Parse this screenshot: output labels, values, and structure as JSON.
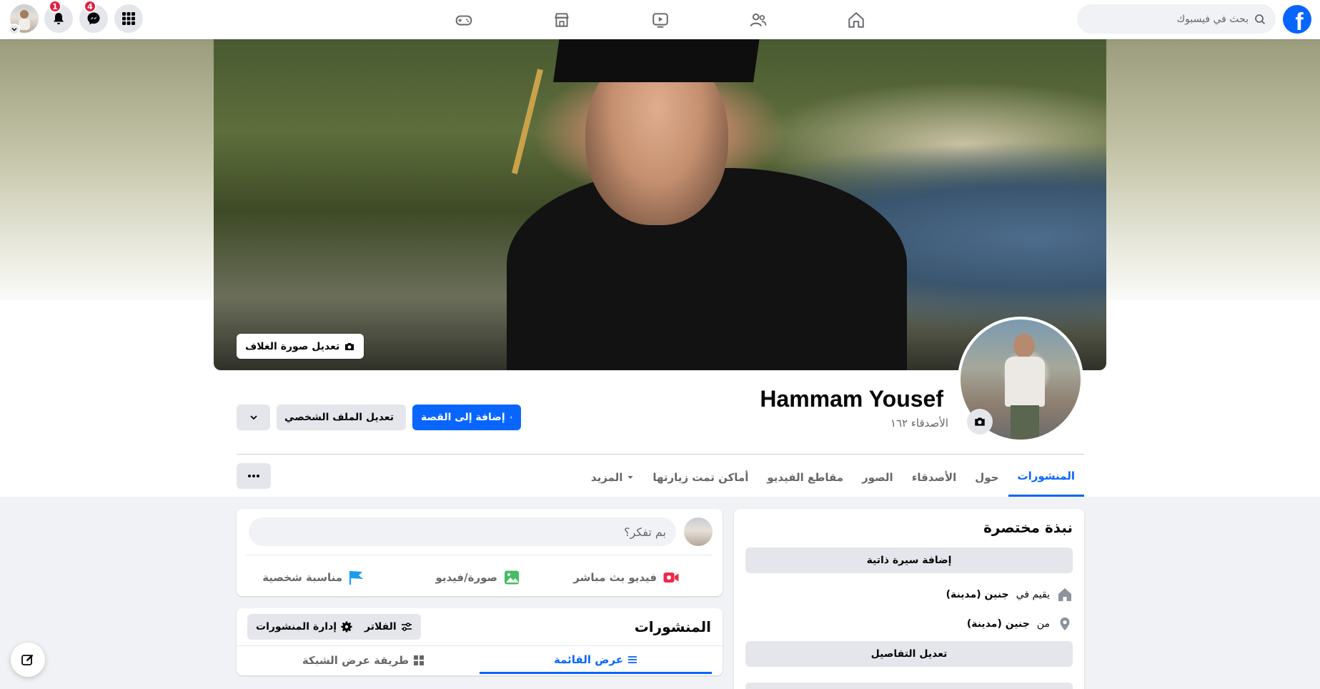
{
  "topnav": {
    "search_placeholder": "بحث في فيسبوك",
    "logo_letter": "f",
    "tabs": [
      "home-icon",
      "friends-icon",
      "watch-icon",
      "marketplace-icon",
      "gaming-icon"
    ],
    "notifications_badge": "1",
    "messenger_badge": "4"
  },
  "cover": {
    "edit_label": "تعديل صورة الغلاف"
  },
  "profile": {
    "name": "Hammam Yousef",
    "friends": "الأصدقاء ١٦٢",
    "add_story": "إضافة إلى القصة",
    "edit_profile": "تعديل الملف الشخصي"
  },
  "tabs": [
    {
      "label": "المنشورات",
      "active": true
    },
    {
      "label": "حول"
    },
    {
      "label": "الأصدقاء"
    },
    {
      "label": "الصور"
    },
    {
      "label": "مقاطع الفيديو"
    },
    {
      "label": "أماكن تمت زيارتها"
    },
    {
      "label": "المزيد"
    }
  ],
  "intro": {
    "title": "نبذة مختصرة",
    "add_bio": "إضافة سيرة ذاتية",
    "lives_prefix": "يقيم في",
    "lives_city": "جنين (مدينة)",
    "from_prefix": "من",
    "from_city": "جنين (مدينة)",
    "edit_details": "تعديل التفاصيل"
  },
  "composer": {
    "placeholder": "بم تفكر؟",
    "live_video": "فيديو بث مباشر",
    "photo_video": "صورة/فيديو",
    "life_event": "مناسبة شخصية"
  },
  "posts": {
    "title": "المنشورات",
    "filters": "الفلاتر",
    "manage": "إدارة المنشورات",
    "list_view": "عرض القائمة",
    "grid_view": "طريقة عرض الشبكة"
  },
  "colors": {
    "brand": "#0866ff",
    "badge": "#e41e3f",
    "live": "#f02849",
    "photo": "#45bd62",
    "event": "#1d9bf0"
  }
}
